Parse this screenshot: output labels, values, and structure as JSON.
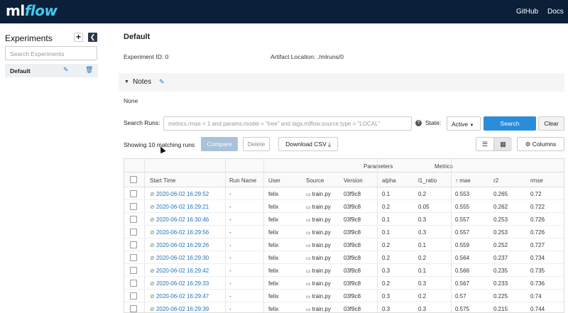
{
  "app": {
    "logo_main": "ml",
    "logo_accent": "flow",
    "nav_links": [
      "GitHub",
      "Docs"
    ]
  },
  "sidebar": {
    "title": "Experiments",
    "add_icon": "plus-icon",
    "collapse_icon": "chevron-left-icon",
    "search_placeholder": "Search Experiments",
    "items": [
      {
        "name": "Default",
        "edit_icon": "pencil-icon",
        "delete_icon": "trash-icon"
      }
    ]
  },
  "experiment": {
    "title": "Default",
    "id_label": "Experiment ID:",
    "id_value": "0",
    "artifact_label": "Artifact Location:",
    "artifact_value": "./mlruns/0"
  },
  "notes": {
    "label": "Notes",
    "body": "None"
  },
  "search": {
    "label": "Search Runs:",
    "value": "metrics.rmse < 1 and params.model = \"tree\" and tags.mlflow.source.type = \"LOCAL\"",
    "state_label": "State:",
    "state_value": "Active",
    "search_button": "Search",
    "clear_button": "Clear"
  },
  "toolbar": {
    "showing_text": "Showing 10 matching runs",
    "compare": "Compare",
    "delete": "Delete",
    "download_csv": "Download CSV",
    "columns": "Columns"
  },
  "table": {
    "group_headers": {
      "parameters": "Parameters",
      "metrics": "Metrics"
    },
    "columns": [
      "Start Time",
      "Run Name",
      "User",
      "Source",
      "Version",
      "alpha",
      "l1_ratio",
      "mae",
      "r2",
      "rmse"
    ],
    "sort_indicator": "↑",
    "rows": [
      {
        "start": "2020-06-02 16:29:52",
        "run_name": "-",
        "user": "felix",
        "source": "train.py",
        "version": "03f9c8",
        "alpha": "0.1",
        "l1_ratio": "0.2",
        "mae": "0.553",
        "r2": "0.265",
        "rmse": "0.72"
      },
      {
        "start": "2020-06-02 16:29:21",
        "run_name": "-",
        "user": "felix",
        "source": "train.py",
        "version": "03f9c8",
        "alpha": "0.2",
        "l1_ratio": "0.05",
        "mae": "0.555",
        "r2": "0.262",
        "rmse": "0.722"
      },
      {
        "start": "2020-06-02 16:30:46",
        "run_name": "-",
        "user": "felix",
        "source": "train.py",
        "version": "03f9c8",
        "alpha": "0.1",
        "l1_ratio": "0.3",
        "mae": "0.557",
        "r2": "0.253",
        "rmse": "0.726"
      },
      {
        "start": "2020-06-02 16:29:56",
        "run_name": "-",
        "user": "felix",
        "source": "train.py",
        "version": "03f9c8",
        "alpha": "0.1",
        "l1_ratio": "0.3",
        "mae": "0.557",
        "r2": "0.253",
        "rmse": "0.726"
      },
      {
        "start": "2020-06-02 16:29:26",
        "run_name": "-",
        "user": "felix",
        "source": "train.py",
        "version": "03f9c8",
        "alpha": "0.2",
        "l1_ratio": "0.1",
        "mae": "0.559",
        "r2": "0.252",
        "rmse": "0.727"
      },
      {
        "start": "2020-06-02 16:29:30",
        "run_name": "-",
        "user": "felix",
        "source": "train.py",
        "version": "03f9c8",
        "alpha": "0.2",
        "l1_ratio": "0.2",
        "mae": "0.564",
        "r2": "0.237",
        "rmse": "0.734"
      },
      {
        "start": "2020-06-02 16:29:42",
        "run_name": "-",
        "user": "felix",
        "source": "train.py",
        "version": "03f9c8",
        "alpha": "0.3",
        "l1_ratio": "0.1",
        "mae": "0.566",
        "r2": "0.235",
        "rmse": "0.735"
      },
      {
        "start": "2020-06-02 16:29:33",
        "run_name": "-",
        "user": "felix",
        "source": "train.py",
        "version": "03f9c8",
        "alpha": "0.2",
        "l1_ratio": "0.3",
        "mae": "0.567",
        "r2": "0.233",
        "rmse": "0.736"
      },
      {
        "start": "2020-06-02 16:29:47",
        "run_name": "-",
        "user": "felix",
        "source": "train.py",
        "version": "03f9c8",
        "alpha": "0.3",
        "l1_ratio": "0.2",
        "mae": "0.57",
        "r2": "0.225",
        "rmse": "0.74"
      },
      {
        "start": "2020-06-02 16:29:39",
        "run_name": "-",
        "user": "felix",
        "source": "train.py",
        "version": "03f9c8",
        "alpha": "0.3",
        "l1_ratio": "0.3",
        "mae": "0.575",
        "r2": "0.215",
        "rmse": "0.744"
      }
    ]
  },
  "colors": {
    "topbar": "#0b1f38",
    "accent": "#43c9ed",
    "primary_button": "#2b8dd9",
    "link": "#2374bb"
  }
}
